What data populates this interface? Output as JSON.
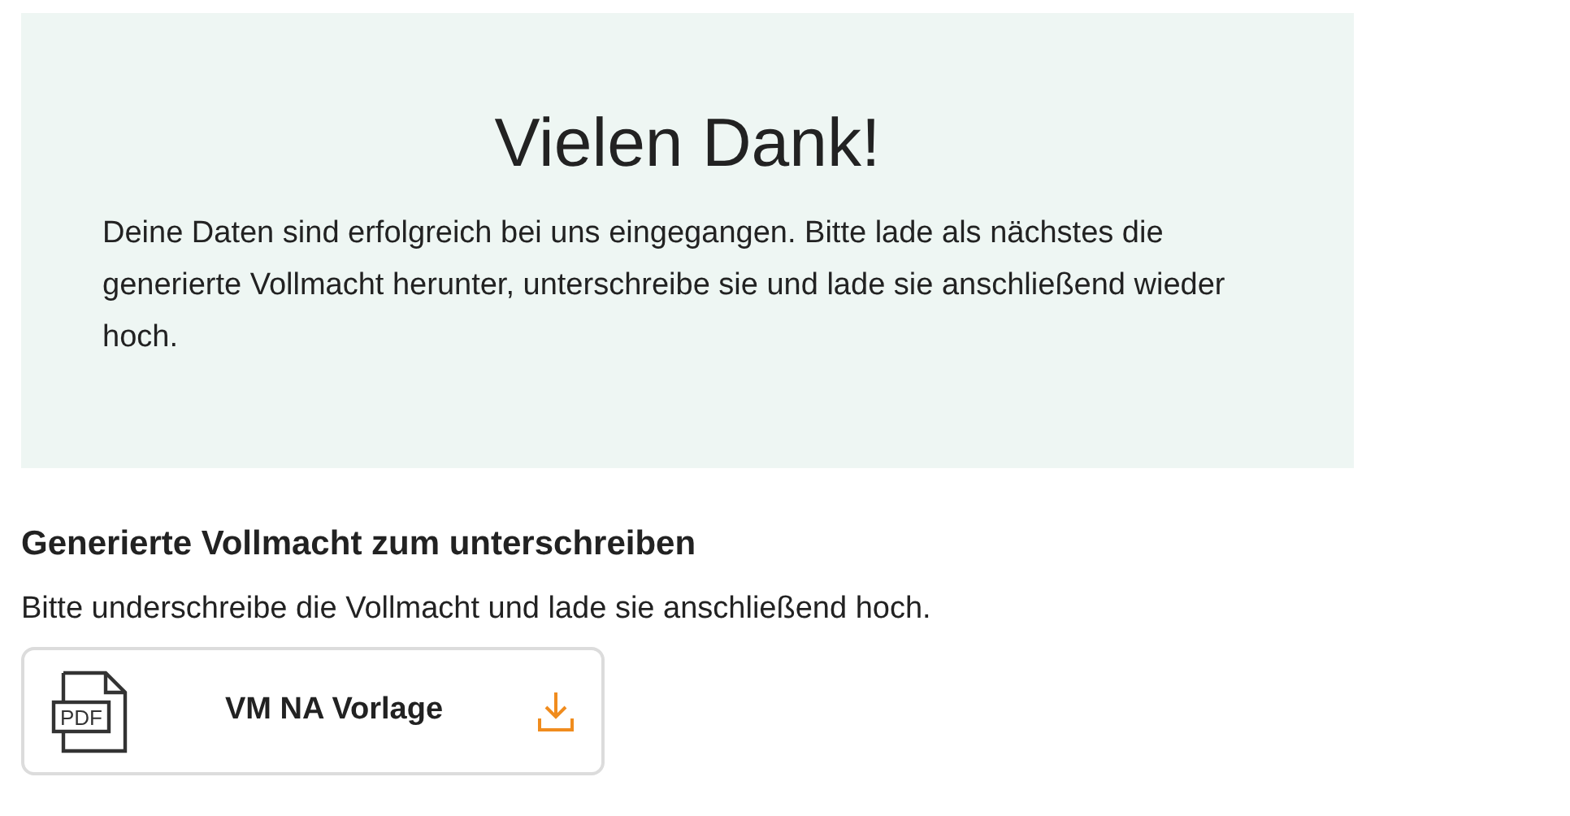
{
  "confirmation": {
    "title": "Vielen Dank!",
    "message": "Deine Daten sind erfolgreich bei uns eingegangen. Bitte lade als nächstes die generierte Vollmacht herunter, unterschreibe sie und lade sie anschließend wieder hoch."
  },
  "document_section": {
    "heading": "Generierte Vollmacht zum unterschreiben",
    "instruction": "Bitte underschreibe die Vollmacht und lade sie anschließend hoch.",
    "files": [
      {
        "file_type": "PDF",
        "name": "VM NA Vorlage"
      }
    ]
  }
}
